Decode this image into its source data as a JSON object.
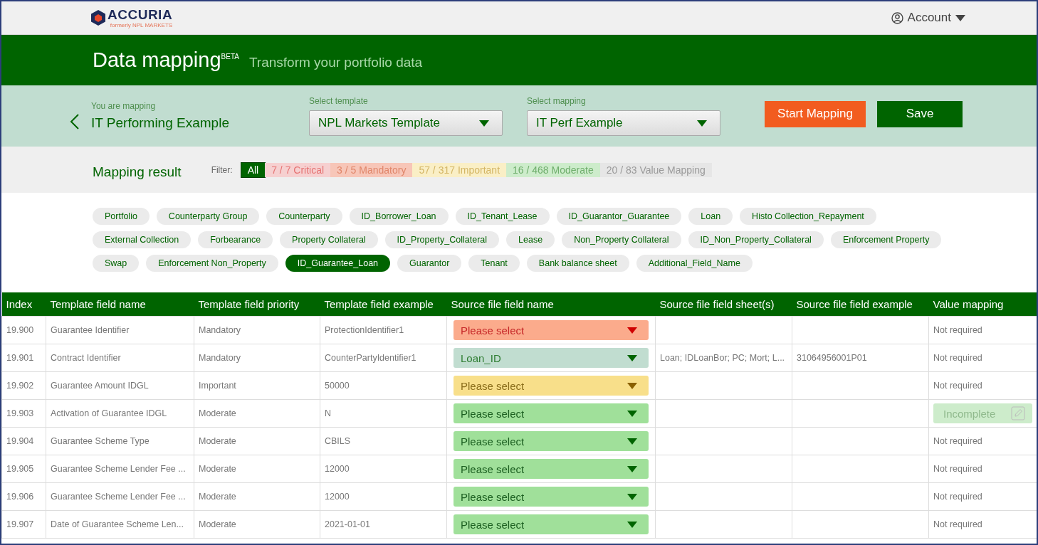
{
  "header": {
    "logo": "ACCURIA",
    "logo_sub": "formerly NPL MARKETS",
    "account": "Account"
  },
  "banner": {
    "title": "Data mapping",
    "badge": "BETA",
    "subtitle": "Transform your portfolio data"
  },
  "mapping": {
    "label": "You are mapping",
    "name": "IT Performing Example",
    "template": {
      "label": "Select template",
      "value": "NPL Markets Template"
    },
    "selection": {
      "label": "Select mapping",
      "value": "IT Perf Example"
    },
    "buttons": [
      {
        "label": "Start Mapping",
        "kind": "primary"
      },
      {
        "label": "Save",
        "kind": "secondary"
      }
    ]
  },
  "result": {
    "title": "Mapping result",
    "filter_label": "Filter:",
    "filters": [
      {
        "label": "All",
        "kind": "all",
        "selected": true
      },
      {
        "label": "7 / 7 Critical",
        "kind": "critical",
        "selected": false
      },
      {
        "label": "3 / 5 Mandatory",
        "kind": "mandatory",
        "selected": false
      },
      {
        "label": "57 / 317 Important",
        "kind": "important",
        "selected": false
      },
      {
        "label": "16 / 468 Moderate",
        "kind": "moderate",
        "selected": false
      },
      {
        "label": "20 / 83 Value Mapping",
        "kind": "value",
        "selected": false
      }
    ]
  },
  "categories": [
    [
      {
        "label": "Portfolio",
        "selected": false
      },
      {
        "label": "Counterparty Group",
        "selected": false
      },
      {
        "label": "Counterparty",
        "selected": false
      },
      {
        "label": "ID_Borrower_Loan",
        "selected": false
      },
      {
        "label": "ID_Tenant_Lease",
        "selected": false
      },
      {
        "label": "ID_Guarantor_Guarantee",
        "selected": false
      },
      {
        "label": "Loan",
        "selected": false
      },
      {
        "label": "Histo Collection_Repayment",
        "selected": false
      }
    ],
    [
      {
        "label": "External Collection",
        "selected": false
      },
      {
        "label": "Forbearance",
        "selected": false
      },
      {
        "label": "Property Collateral",
        "selected": false
      },
      {
        "label": "ID_Property_Collateral",
        "selected": false
      },
      {
        "label": "Lease",
        "selected": false
      },
      {
        "label": "Non_Property Collateral",
        "selected": false
      },
      {
        "label": "ID_Non_Property_Collateral",
        "selected": false
      },
      {
        "label": "Enforcement Property",
        "selected": false
      }
    ],
    [
      {
        "label": "Swap",
        "selected": false
      },
      {
        "label": "Enforcement Non_Property",
        "selected": false
      },
      {
        "label": "ID_Guarantee_Loan",
        "selected": true
      },
      {
        "label": "Guarantor",
        "selected": false
      },
      {
        "label": "Tenant",
        "selected": false
      },
      {
        "label": "Bank balance sheet",
        "selected": false
      },
      {
        "label": "Additional_Field_Name",
        "selected": false
      }
    ]
  ],
  "table": {
    "columns": [
      "Index",
      "Template field name",
      "Template field priority",
      "Template field example",
      "Source file field name",
      "Source file field sheet(s)",
      "Source file field example",
      "Value mapping"
    ],
    "rows": [
      {
        "index": "19.900",
        "name": "Guarantee Identifier",
        "priority": "Mandatory",
        "example": "ProtectionIdentifier1",
        "source": {
          "value": "Please select",
          "kind": "critical"
        },
        "sheets": "",
        "source_example": "",
        "value_mapping": {
          "text": "Not required",
          "kind": "text"
        }
      },
      {
        "index": "19.901",
        "name": "Contract Identifier",
        "priority": "Mandatory",
        "example": "CounterPartyIdentifier1",
        "source": {
          "value": "Loan_ID",
          "kind": "mapped"
        },
        "sheets": "Loan; IDLoanBor; PC; Mort; L...",
        "source_example": "31064956001P01",
        "value_mapping": {
          "text": "Not required",
          "kind": "text"
        }
      },
      {
        "index": "19.902",
        "name": "Guarantee Amount IDGL",
        "priority": "Important",
        "example": "50000",
        "source": {
          "value": "Please select",
          "kind": "important"
        },
        "sheets": "",
        "source_example": "",
        "value_mapping": {
          "text": "Not required",
          "kind": "text"
        }
      },
      {
        "index": "19.903",
        "name": "Activation of Guarantee IDGL",
        "priority": "Moderate",
        "example": "N",
        "source": {
          "value": "Please select",
          "kind": "moderate"
        },
        "sheets": "",
        "source_example": "",
        "value_mapping": {
          "text": "Incomplete",
          "kind": "incomplete"
        }
      },
      {
        "index": "19.904",
        "name": "Guarantee Scheme Type",
        "priority": "Moderate",
        "example": "CBILS",
        "source": {
          "value": "Please select",
          "kind": "moderate"
        },
        "sheets": "",
        "source_example": "",
        "value_mapping": {
          "text": "Not required",
          "kind": "text"
        }
      },
      {
        "index": "19.905",
        "name": "Guarantee Scheme Lender Fee ...",
        "priority": "Moderate",
        "example": "12000",
        "source": {
          "value": "Please select",
          "kind": "moderate"
        },
        "sheets": "",
        "source_example": "",
        "value_mapping": {
          "text": "Not required",
          "kind": "text"
        }
      },
      {
        "index": "19.906",
        "name": "Guarantee Scheme Lender Fee ...",
        "priority": "Moderate",
        "example": "12000",
        "source": {
          "value": "Please select",
          "kind": "moderate"
        },
        "sheets": "",
        "source_example": "",
        "value_mapping": {
          "text": "Not required",
          "kind": "text"
        }
      },
      {
        "index": "19.907",
        "name": "Date of Guarantee Scheme Len...",
        "priority": "Moderate",
        "example": "2021-01-01",
        "source": {
          "value": "Please select",
          "kind": "moderate"
        },
        "sheets": "",
        "source_example": "",
        "value_mapping": {
          "text": "Not required",
          "kind": "text"
        }
      }
    ]
  }
}
